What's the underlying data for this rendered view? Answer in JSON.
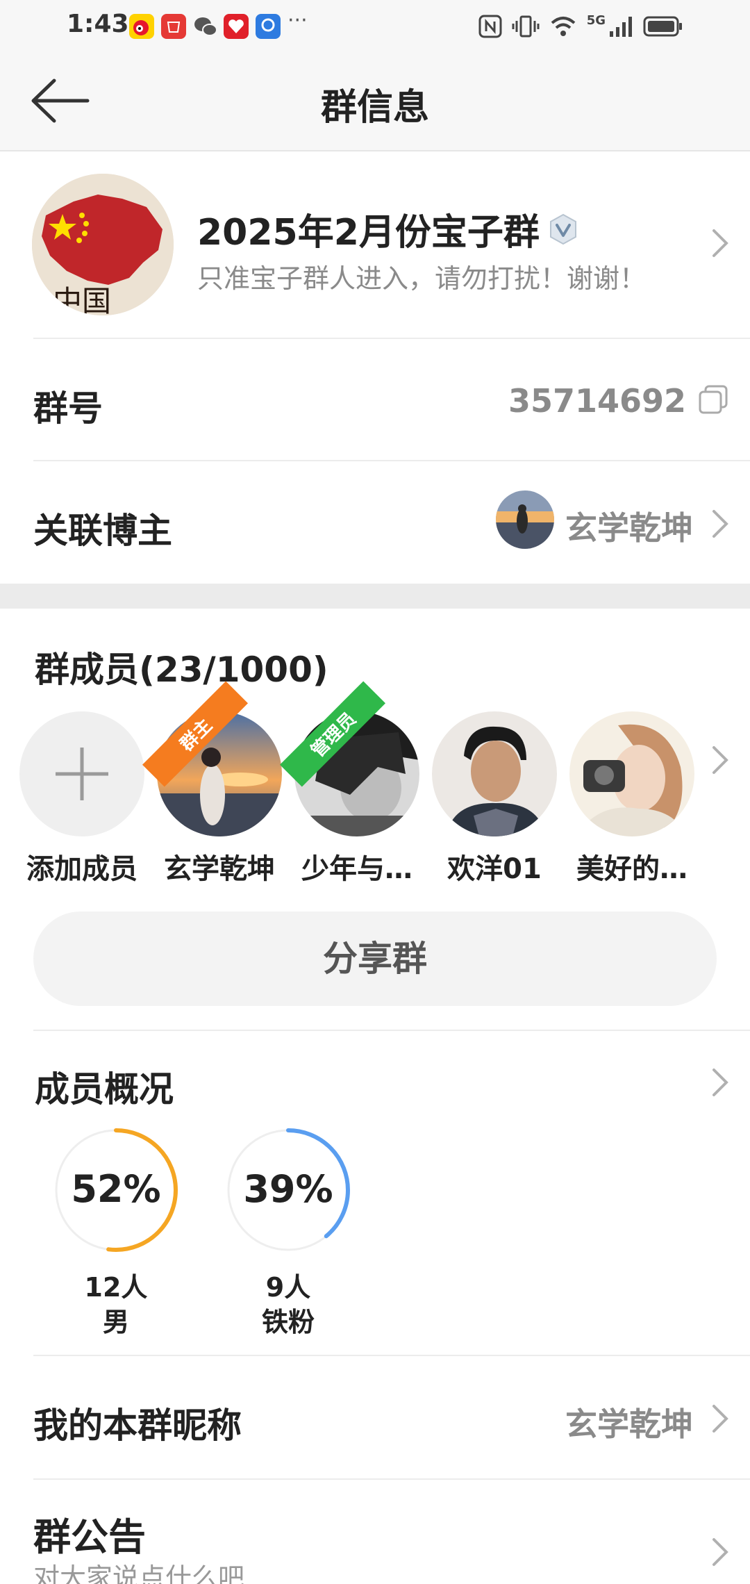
{
  "status_bar": {
    "time": "1:43",
    "network": "5G",
    "more": "···"
  },
  "header": {
    "title": "群信息"
  },
  "group": {
    "name": "2025年2月份宝子群",
    "description": "只准宝子群人进入，请勿打扰！谢谢！"
  },
  "group_id_row": {
    "label": "群号",
    "value": "35714692"
  },
  "blogger_row": {
    "label": "关联博主",
    "name": "玄学乾坤"
  },
  "members": {
    "title": "群成员(23/1000)",
    "add_label": "添加成员",
    "list": [
      {
        "name": "玄学乾坤",
        "badge": "群主"
      },
      {
        "name": "少年与…",
        "badge": "管理员"
      },
      {
        "name": "欢洋01",
        "badge": ""
      },
      {
        "name": "美好的…",
        "badge": ""
      }
    ]
  },
  "share_button": "分享群",
  "overview": {
    "title": "成员概况",
    "stats": [
      {
        "percent": "52%",
        "value": 0.52,
        "count": "12人",
        "label": "男",
        "color": "#f5a623"
      },
      {
        "percent": "39%",
        "value": 0.39,
        "count": "9人",
        "label": "铁粉",
        "color": "#5a9ef0"
      }
    ]
  },
  "nickname_row": {
    "label": "我的本群昵称",
    "value": "玄学乾坤"
  },
  "notice_row": {
    "label": "群公告",
    "placeholder": "对大家说点什么吧"
  }
}
